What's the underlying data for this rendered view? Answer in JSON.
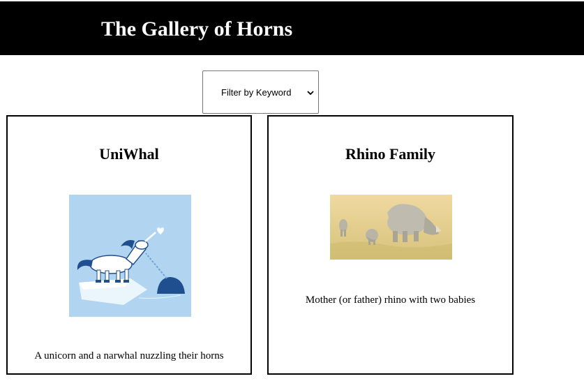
{
  "header": {
    "title": "The Gallery of Horns"
  },
  "filter": {
    "selected": "Filter by Keyword"
  },
  "cards": [
    {
      "title": "UniWhal",
      "description": "A unicorn and a narwhal nuzzling their horns",
      "image_icon": "unicorn-narwhal-illustration"
    },
    {
      "title": "Rhino Family",
      "description": "Mother (or father) rhino with two babies",
      "image_icon": "rhino-family-photo"
    }
  ],
  "colors": {
    "header_bg": "#000000",
    "header_text": "#ffffff",
    "uni_bg": "#b1d5f1",
    "uni_dark": "#1f4f8f"
  }
}
